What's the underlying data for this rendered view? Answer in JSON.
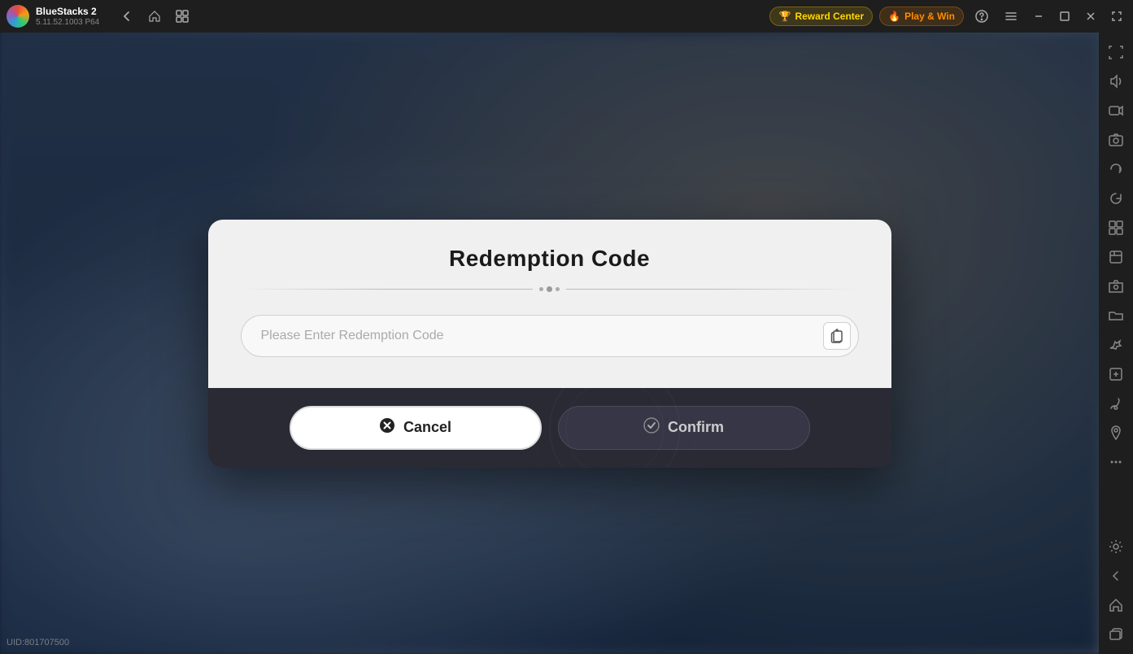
{
  "app": {
    "name": "BlueStacks 2",
    "version": "5.11.52.1003",
    "arch": "P64"
  },
  "titlebar": {
    "back_label": "←",
    "home_label": "⌂",
    "tabs_label": "⧉",
    "reward_label": "Reward Center",
    "play_label": "Play & Win",
    "help_label": "?",
    "menu_label": "≡",
    "minimize_label": "—",
    "maximize_label": "□",
    "close_label": "✕",
    "expand_label": "⤢"
  },
  "sidebar": {
    "buttons": [
      {
        "name": "fullscreen",
        "icon": "⤢"
      },
      {
        "name": "volume",
        "icon": "🔊"
      },
      {
        "name": "screen-record",
        "icon": "▶"
      },
      {
        "name": "screenshot",
        "icon": "📷"
      },
      {
        "name": "sync",
        "icon": "↻"
      },
      {
        "name": "rotate",
        "icon": "⟳"
      },
      {
        "name": "apps",
        "icon": "⊞"
      },
      {
        "name": "media",
        "icon": "📄"
      },
      {
        "name": "camera",
        "icon": "📷"
      },
      {
        "name": "folder",
        "icon": "📁"
      },
      {
        "name": "flight",
        "icon": "✈"
      },
      {
        "name": "scale",
        "icon": "⊡"
      },
      {
        "name": "brush",
        "icon": "✏"
      },
      {
        "name": "location",
        "icon": "📍"
      },
      {
        "name": "more",
        "icon": "•••"
      },
      {
        "name": "settings",
        "icon": "⚙"
      },
      {
        "name": "back",
        "icon": "←"
      },
      {
        "name": "home-bottom",
        "icon": "⌂"
      },
      {
        "name": "multi",
        "icon": "⊟"
      }
    ]
  },
  "dialog": {
    "title": "Redemption Code",
    "input_placeholder": "Please Enter Redemption Code",
    "cancel_label": "Cancel",
    "confirm_label": "Confirm",
    "paste_icon": "📋"
  },
  "footer": {
    "uid": "UID:801707500"
  }
}
